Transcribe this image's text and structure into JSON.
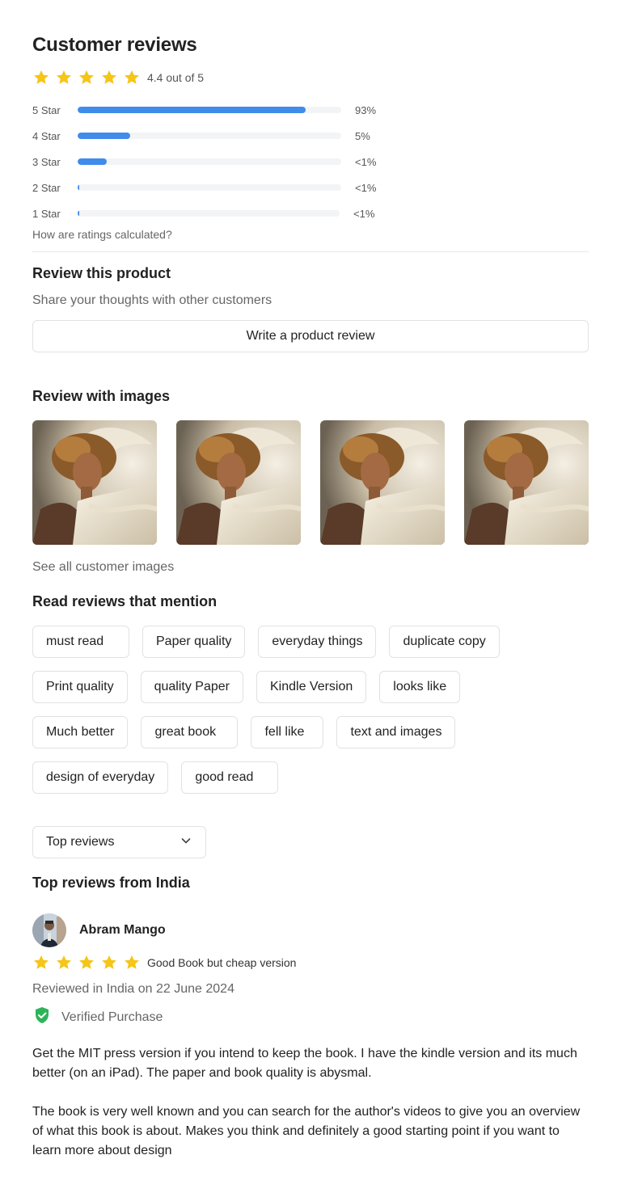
{
  "header": {
    "title": "Customer reviews"
  },
  "overall": {
    "rating": 4.4,
    "stars": 5,
    "text": "4.4 out of 5"
  },
  "histogram": [
    {
      "label": "5 Star",
      "fraction": 0.865,
      "pct": "93%"
    },
    {
      "label": "4 Star",
      "fraction": 0.2,
      "pct": "5%"
    },
    {
      "label": "3 Star",
      "fraction": 0.11,
      "pct": "<1%"
    },
    {
      "label": "2 Star",
      "fraction": 0.007,
      "pct": "<1%"
    },
    {
      "label": "1 Star",
      "fraction": 0.007,
      "pct": "<1%"
    }
  ],
  "how_link": "How are ratings calculated?",
  "review_product": {
    "title": "Review this product",
    "subtitle": "Share your thoughts with other customers",
    "button": "Write a product review"
  },
  "images_section": {
    "title": "Review with images",
    "see_all": "See all customer images"
  },
  "mentions": {
    "title": "Read reviews that mention",
    "rows": [
      [
        "must read",
        "Paper quality",
        "everyday things",
        "duplicate copy"
      ],
      [
        "Print quality",
        "quality Paper",
        "Kindle Version",
        "looks like"
      ],
      [
        "Much better",
        "great book",
        "fell like",
        "text and images"
      ],
      [
        "design of everyday",
        "good read"
      ]
    ]
  },
  "sort": {
    "value": "Top reviews"
  },
  "top_reviews": {
    "title": "Top reviews from India",
    "review": {
      "author": "Abram Mango",
      "stars": 5,
      "headline": "Good Book but cheap version",
      "date_line": "Reviewed in India on 22 June 2024",
      "verified": "Verified Purchase",
      "paragraph1": "Get the MIT press version if you intend to keep the book. I have the kindle version and its much better (on an iPad). The paper and book quality is abysmal.",
      "paragraph2": "The book is very well known and you can search for the author's videos to give you an overview of what this book is about. Makes you think and definitely a good starting point if you want to learn more about design"
    }
  },
  "colors": {
    "star": "#f5c518",
    "bar": "#3f8cea",
    "verified": "#2fb35a"
  }
}
